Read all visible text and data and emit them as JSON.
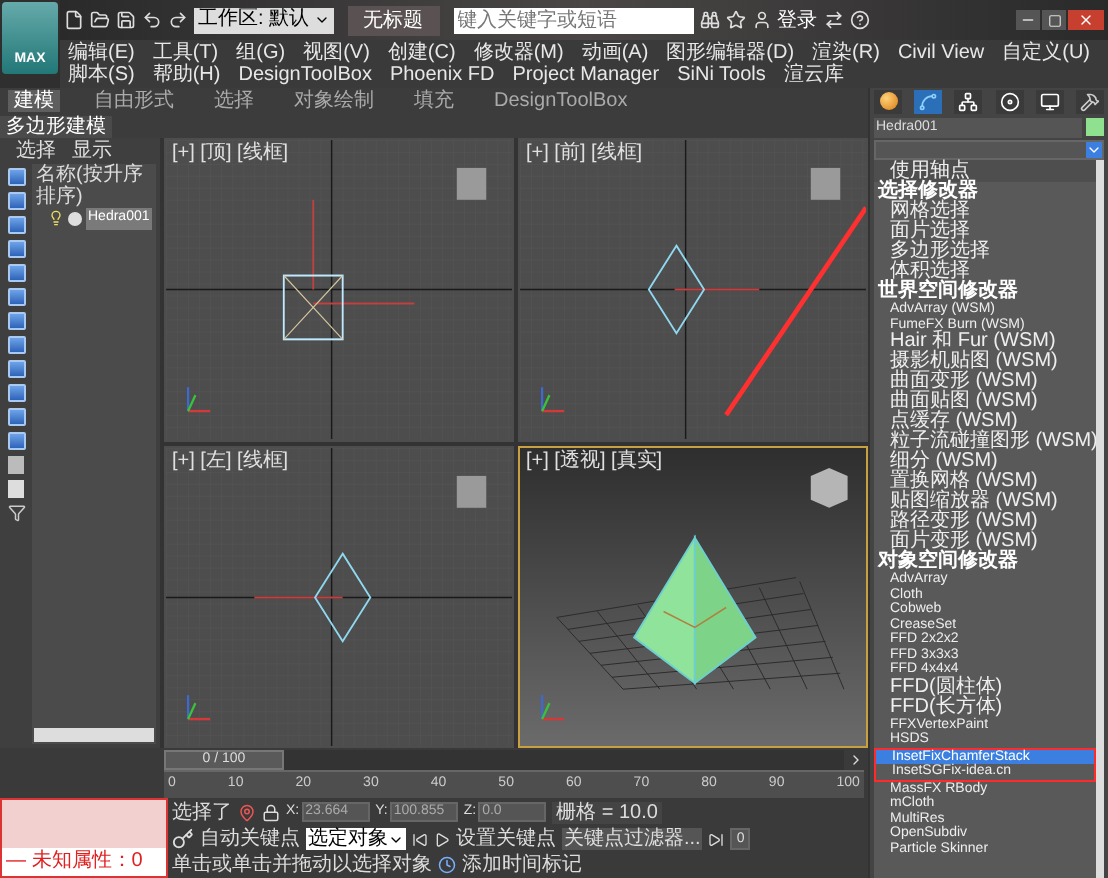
{
  "app_button": "MAX",
  "title_bar": {
    "workspace": "工作区: 默认",
    "title": "无标题",
    "search": {
      "placeholder": "键入关键字或短语"
    },
    "login": "登录"
  },
  "menus": [
    "编辑(E)",
    "工具(T)",
    "组(G)",
    "视图(V)",
    "创建(C)",
    "修改器(M)",
    "动画(A)",
    "图形编辑器(D)",
    "渲染(R)",
    "Civil View",
    "自定义(U)",
    "脚本(S)",
    "帮助(H)",
    "DesignToolBox",
    "Phoenix FD",
    "Project Manager",
    "SiNi Tools",
    "渲云库"
  ],
  "ribbon": {
    "tabs": [
      {
        "label": "建模",
        "selected": true
      },
      {
        "label": "自由形式",
        "selected": false
      },
      {
        "label": "选择",
        "selected": false
      },
      {
        "label": "对象绘制",
        "selected": false
      },
      {
        "label": "填充",
        "selected": false
      },
      {
        "label": "DesignToolBox",
        "selected": false
      }
    ],
    "panel": "多边形建模"
  },
  "scene_explorer": {
    "tabs": [
      "选择",
      "显示"
    ],
    "column": "名称(按升序排序)",
    "items": [
      {
        "name": "Hedra001",
        "selected": true
      }
    ]
  },
  "viewports": [
    {
      "kind": "top",
      "label": "[+] [顶] [线框]",
      "active": false
    },
    {
      "kind": "front",
      "label": "[+] [前] [线框]",
      "active": false
    },
    {
      "kind": "left",
      "label": "[+] [左] [线框]",
      "active": false
    },
    {
      "kind": "perspective",
      "label": "[+] [透视] [真实]",
      "active": true
    }
  ],
  "command_panel": {
    "tabs": [
      {
        "kind": "create",
        "selected": false
      },
      {
        "kind": "modify",
        "selected": true
      },
      {
        "kind": "hierarchy",
        "selected": false
      },
      {
        "kind": "motion",
        "selected": false
      },
      {
        "kind": "display",
        "selected": false
      },
      {
        "kind": "utilities",
        "selected": false
      }
    ],
    "object_name": "Hedra001",
    "modifier_list": {
      "pinned": "使用轴点",
      "items": [
        {
          "kind": "section",
          "label": "选择修改器",
          "selected": false,
          "marked": false
        },
        {
          "kind": "item",
          "label": "网格选择",
          "selected": false,
          "marked": false
        },
        {
          "kind": "item",
          "label": "面片选择",
          "selected": false,
          "marked": false
        },
        {
          "kind": "item",
          "label": "多边形选择",
          "selected": false,
          "marked": false
        },
        {
          "kind": "item",
          "label": "体积选择",
          "selected": false,
          "marked": false
        },
        {
          "kind": "section",
          "label": "世界空间修改器",
          "selected": false,
          "marked": false
        },
        {
          "kind": "item",
          "label": "AdvArray (WSM)",
          "selected": false,
          "marked": false
        },
        {
          "kind": "item",
          "label": "FumeFX Burn (WSM)",
          "selected": false,
          "marked": false
        },
        {
          "kind": "item",
          "label": "Hair 和 Fur (WSM)",
          "selected": false,
          "marked": false
        },
        {
          "kind": "item",
          "label": "摄影机贴图 (WSM)",
          "selected": false,
          "marked": false
        },
        {
          "kind": "item",
          "label": "曲面变形 (WSM)",
          "selected": false,
          "marked": false
        },
        {
          "kind": "item",
          "label": "曲面贴图 (WSM)",
          "selected": false,
          "marked": false
        },
        {
          "kind": "item",
          "label": "点缓存 (WSM)",
          "selected": false,
          "marked": false
        },
        {
          "kind": "item",
          "label": "粒子流碰撞图形 (WSM)",
          "selected": false,
          "marked": false
        },
        {
          "kind": "item",
          "label": "细分 (WSM)",
          "selected": false,
          "marked": false
        },
        {
          "kind": "item",
          "label": "置换网格 (WSM)",
          "selected": false,
          "marked": false
        },
        {
          "kind": "item",
          "label": "贴图缩放器 (WSM)",
          "selected": false,
          "marked": false
        },
        {
          "kind": "item",
          "label": "路径变形 (WSM)",
          "selected": false,
          "marked": false
        },
        {
          "kind": "item",
          "label": "面片变形 (WSM)",
          "selected": false,
          "marked": false
        },
        {
          "kind": "section",
          "label": "对象空间修改器",
          "selected": false,
          "marked": false
        },
        {
          "kind": "item",
          "label": "AdvArray",
          "selected": false,
          "marked": false
        },
        {
          "kind": "item",
          "label": "Cloth",
          "selected": false,
          "marked": false
        },
        {
          "kind": "item",
          "label": "Cobweb",
          "selected": false,
          "marked": false
        },
        {
          "kind": "item",
          "label": "CreaseSet",
          "selected": false,
          "marked": false
        },
        {
          "kind": "item",
          "label": "FFD 2x2x2",
          "selected": false,
          "marked": false
        },
        {
          "kind": "item",
          "label": "FFD 3x3x3",
          "selected": false,
          "marked": false
        },
        {
          "kind": "item",
          "label": "FFD 4x4x4",
          "selected": false,
          "marked": false
        },
        {
          "kind": "item",
          "label": "FFD(圆柱体)",
          "selected": false,
          "marked": false
        },
        {
          "kind": "item",
          "label": "FFD(长方体)",
          "selected": false,
          "marked": false
        },
        {
          "kind": "item",
          "label": "FFXVertexPaint",
          "selected": false,
          "marked": false
        },
        {
          "kind": "item",
          "label": "HSDS",
          "selected": false,
          "marked": false
        },
        {
          "kind": "item",
          "label": "InsetFixChamferStack",
          "selected": true,
          "marked": true
        },
        {
          "kind": "item",
          "label": "InsetSGFix-idea.cn",
          "selected": false,
          "marked": true
        },
        {
          "kind": "item",
          "label": "MassFX RBody",
          "selected": false,
          "marked": false
        },
        {
          "kind": "item",
          "label": "mCloth",
          "selected": false,
          "marked": false
        },
        {
          "kind": "item",
          "label": "MultiRes",
          "selected": false,
          "marked": false
        },
        {
          "kind": "item",
          "label": "OpenSubdiv",
          "selected": false,
          "marked": false
        },
        {
          "kind": "item",
          "label": "Particle Skinner",
          "selected": false,
          "marked": false
        }
      ]
    }
  },
  "timeline": {
    "frame": "0 / 100",
    "level": 0,
    "ticks": [
      "0",
      "10",
      "20",
      "30",
      "40",
      "50",
      "60",
      "70",
      "80",
      "90",
      "100"
    ]
  },
  "status_bar": {
    "listener": "— 未知属性：0",
    "selection": "选择了",
    "coords": [
      {
        "axis": "X:",
        "value": "23.664"
      },
      {
        "axis": "Y:",
        "value": "100.855"
      },
      {
        "axis": "Z:",
        "value": "0.0"
      }
    ],
    "grid": "栅格 = 10.0",
    "auto_key": "自动关键点",
    "key_mode": "选定对象",
    "set_key": "设置关键点",
    "key_filters": "关键点过滤器...",
    "frame": "0",
    "prompt": "单击或单击并拖动以选择对象",
    "add_time_tag": "添加时间标记"
  }
}
